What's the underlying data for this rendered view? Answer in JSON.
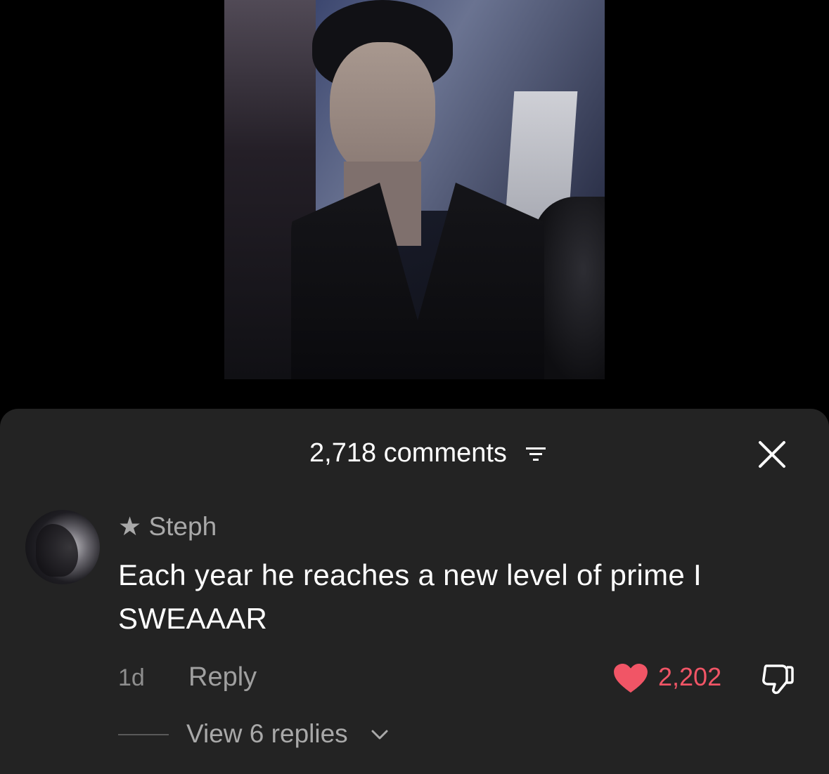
{
  "comments_sheet": {
    "count_label": "2,718 comments",
    "sort_icon": "sort-lines-icon",
    "close_icon": "close-icon"
  },
  "comment": {
    "username": "★ Steph",
    "text": "Each year he reaches a new level of prime I SWEAAAR",
    "timestamp": "1d",
    "reply_label": "Reply",
    "like_count": "2,202",
    "liked": true,
    "view_replies_label": "View 6 replies"
  },
  "colors": {
    "sheet_bg": "#232323",
    "like_red": "#f15566",
    "muted_text": "#a9a9a9"
  }
}
